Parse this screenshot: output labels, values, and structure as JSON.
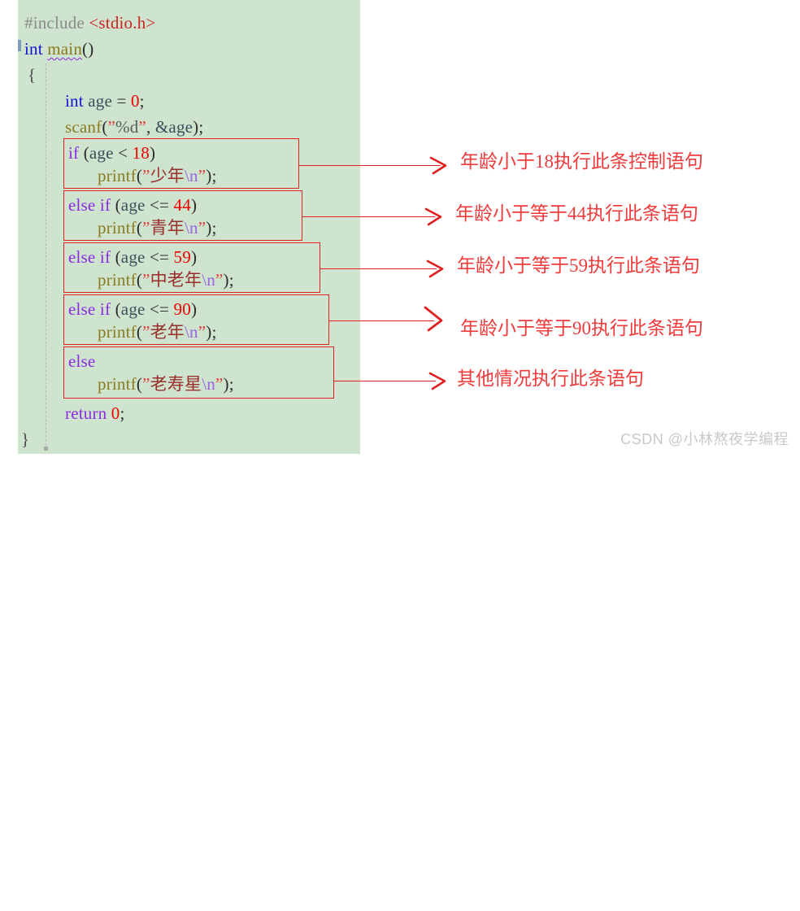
{
  "code_panel": {
    "background_color": "#cfe4ce",
    "lines": [
      {
        "id": "l1",
        "text": "#include <stdio.h>"
      },
      {
        "id": "l2",
        "text": "int main()"
      },
      {
        "id": "l3",
        "text": "{"
      },
      {
        "id": "l4",
        "text": "    int age = 0;"
      },
      {
        "id": "l5",
        "text": "    scanf(\"%d\", &age);"
      },
      {
        "id": "l6",
        "text": "    if (age < 18)"
      },
      {
        "id": "l7",
        "text": "        printf(\"少年\\n\");"
      },
      {
        "id": "l8",
        "text": "    else if (age <= 44)"
      },
      {
        "id": "l9",
        "text": "        printf(\"青年\\n\");"
      },
      {
        "id": "l10",
        "text": "    else if (age <= 59)"
      },
      {
        "id": "l11",
        "text": "        printf(\"中老年\\n\");"
      },
      {
        "id": "l12",
        "text": "    else if (age <= 90)"
      },
      {
        "id": "l13",
        "text": "        printf(\"老年\\n\");"
      },
      {
        "id": "l14",
        "text": "    else"
      },
      {
        "id": "l15",
        "text": "        printf(\"老寿星\\n\");"
      },
      {
        "id": "l16",
        "text": "    return 0;"
      },
      {
        "id": "l17",
        "text": "}"
      }
    ],
    "tokens": {
      "include_directive": "#include",
      "include_header": "<stdio.h>",
      "kw_int": "int",
      "fn_main": "main",
      "paren_empty": "()",
      "brace_open": "{",
      "brace_close": "}",
      "var_age": "age",
      "assign": "=",
      "zero": "0",
      "semicolon": ";",
      "fn_scanf": "scanf",
      "fmt_d": "%d",
      "addr_age": "&age",
      "kw_if": "if",
      "kw_else": "else",
      "kw_return": "return",
      "fn_printf": "printf",
      "esc_n": "\\n",
      "op_lt": "<",
      "op_le": "<=",
      "num_18": "18",
      "num_44": "44",
      "num_59": "59",
      "num_90": "90",
      "str_shaonian": "少年",
      "str_qingnian": "青年",
      "str_zhonglaonian": "中老年",
      "str_laonian": "老年",
      "str_laoshouxing": "老寿星"
    },
    "colors": {
      "preprocessor": "#8a8a8a",
      "header": "#cc2222",
      "type_keyword": "#1414d6",
      "control_keyword": "#8a2be2",
      "function": "#8a7b1f",
      "variable": "#3d4f5c",
      "number": "#ee0000",
      "string": "#9b2c2c",
      "escape": "#9a63e8",
      "quote": "#e03b3b"
    }
  },
  "highlight_boxes": [
    {
      "id": "box-if-18",
      "label": "if (age < 18) block"
    },
    {
      "id": "box-elseif-44",
      "label": "else if (age <= 44) block"
    },
    {
      "id": "box-elseif-59",
      "label": "else if (age <= 59) block"
    },
    {
      "id": "box-elseif-90",
      "label": "else if (age <= 90) block"
    },
    {
      "id": "box-else",
      "label": "else block"
    }
  ],
  "annotations": [
    {
      "id": "anno-1",
      "text": "年龄小于18执行此条控制语句"
    },
    {
      "id": "anno-2",
      "text": "年龄小于等于44执行此条语句"
    },
    {
      "id": "anno-3",
      "text": "年龄小于等于59执行此条语句"
    },
    {
      "id": "anno-4",
      "text": "年龄小于等于90执行此条语句"
    },
    {
      "id": "anno-5",
      "text": "其他情况执行此条语句"
    }
  ],
  "annotation_color": "#ef3b3b",
  "watermark": {
    "text": "CSDN @小林熬夜学编程",
    "color": "#c9c9c9"
  }
}
